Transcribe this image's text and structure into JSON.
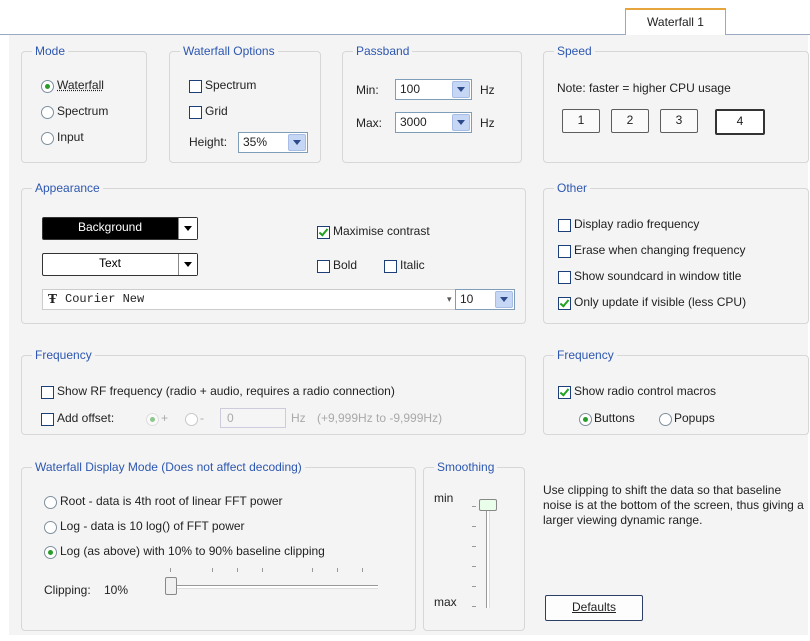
{
  "tab": {
    "label": "Waterfall 1"
  },
  "mode": {
    "title": "Mode",
    "options": [
      "Waterfall",
      "Spectrum",
      "Input"
    ],
    "selected": "Waterfall"
  },
  "waterfall_options": {
    "title": "Waterfall Options",
    "spectrum_label": "Spectrum",
    "grid_label": "Grid",
    "height_label": "Height:",
    "height_value": "35%"
  },
  "passband": {
    "title": "Passband",
    "min_label": "Min:",
    "min_value": "100",
    "max_label": "Max:",
    "max_value": "3000",
    "unit": "Hz"
  },
  "speed": {
    "title": "Speed",
    "note": "Note: faster = higher CPU usage",
    "buttons": [
      "1",
      "2",
      "3",
      "4"
    ],
    "selected": "4"
  },
  "appearance": {
    "title": "Appearance",
    "background_label": "Background",
    "text_label": "Text",
    "maximise_contrast_label": "Maximise contrast",
    "bold_label": "Bold",
    "italic_label": "Italic",
    "font_value": "Courier New",
    "font_size": "10"
  },
  "other": {
    "title": "Other",
    "items": [
      {
        "label": "Display radio frequency",
        "checked": false
      },
      {
        "label": "Erase when changing frequency",
        "checked": false
      },
      {
        "label": "Show soundcard in window title",
        "checked": false
      },
      {
        "label": "Only update if visible (less CPU)",
        "checked": true
      }
    ]
  },
  "frequency_left": {
    "title": "Frequency",
    "show_rf_label": "Show RF frequency (radio + audio, requires a radio connection)",
    "add_offset_label": "Add offset:",
    "plus_label": "+",
    "minus_label": "-",
    "offset_value": "0",
    "unit": "Hz",
    "range_hint": "(+9,999Hz to -9,999Hz)"
  },
  "frequency_right": {
    "title": "Frequency",
    "show_radio_macros_label": "Show radio control macros",
    "buttons_label": "Buttons",
    "popups_label": "Popups"
  },
  "display_mode": {
    "title": "Waterfall Display Mode (Does not affect decoding)",
    "options": [
      "Root - data is 4th root of linear FFT power",
      "Log - data is 10 log() of FFT power",
      "Log (as above) with 10% to 90% baseline clipping"
    ],
    "selected_index": 2,
    "clipping_label": "Clipping:",
    "clipping_value": "10%",
    "clipping_fraction": 0.0
  },
  "smoothing": {
    "title": "Smoothing",
    "min_label": "min",
    "max_label": "max",
    "level_fraction": 0.0
  },
  "help_text": "Use clipping to shift the data so that baseline noise is at the bottom of the screen, thus giving a larger viewing dynamic range.",
  "defaults_button": "Defaults",
  "icons": {
    "font_icon": "truetype-font-icon"
  }
}
